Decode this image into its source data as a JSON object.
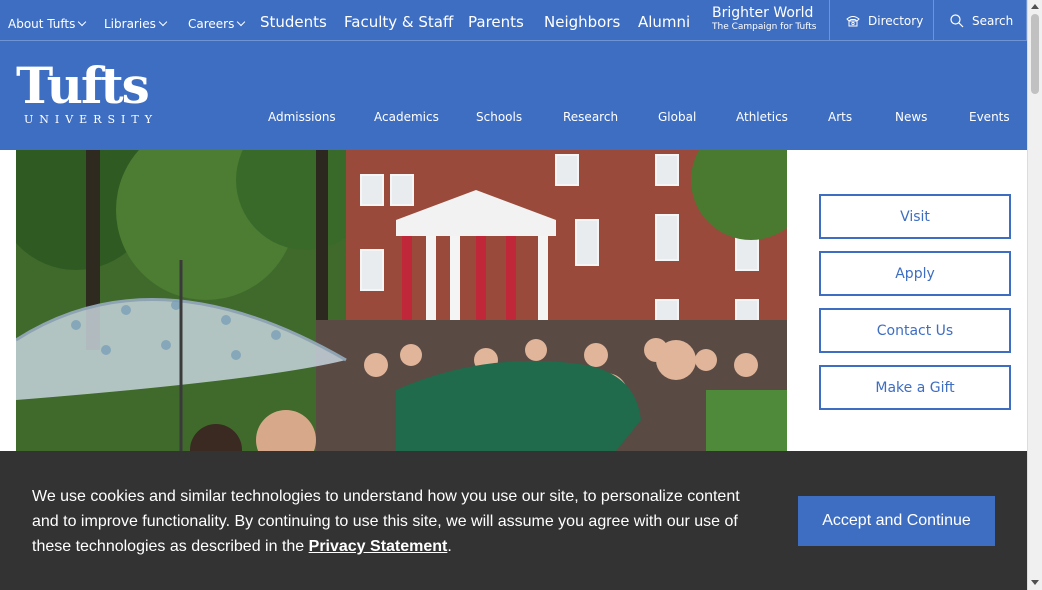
{
  "colors": {
    "brand_blue": "#3e6ec2",
    "cookie_bg": "#333333",
    "white": "#ffffff"
  },
  "topbar": {
    "about": "About Tufts",
    "libraries": "Libraries",
    "careers": "Careers",
    "students": "Students",
    "faculty_staff": "Faculty & Staff",
    "parents": "Parents",
    "neighbors": "Neighbors",
    "alumni": "Alumni",
    "brighter_world": "Brighter World",
    "campaign": "The Campaign for Tufts",
    "directory": "Directory",
    "search": "Search"
  },
  "logo": {
    "word": "Tufts",
    "subword": "UNIVERSITY"
  },
  "nav": {
    "admissions": "Admissions",
    "academics": "Academics",
    "schools": "Schools",
    "research": "Research",
    "global": "Global",
    "athletics": "Athletics",
    "arts": "Arts",
    "news": "News",
    "events": "Events"
  },
  "sidebar": {
    "visit": "Visit",
    "apply": "Apply",
    "contact": "Contact Us",
    "gift": "Make a Gift"
  },
  "cookie": {
    "text_before": "We use cookies and similar technologies to understand how you use our site, to personalize content and to improve functionality. By continuing to use this site, we will assume you agree with our use of these technologies as described in the",
    "link": "Privacy Statement",
    "text_after": ".",
    "accept": "Accept and Continue"
  }
}
